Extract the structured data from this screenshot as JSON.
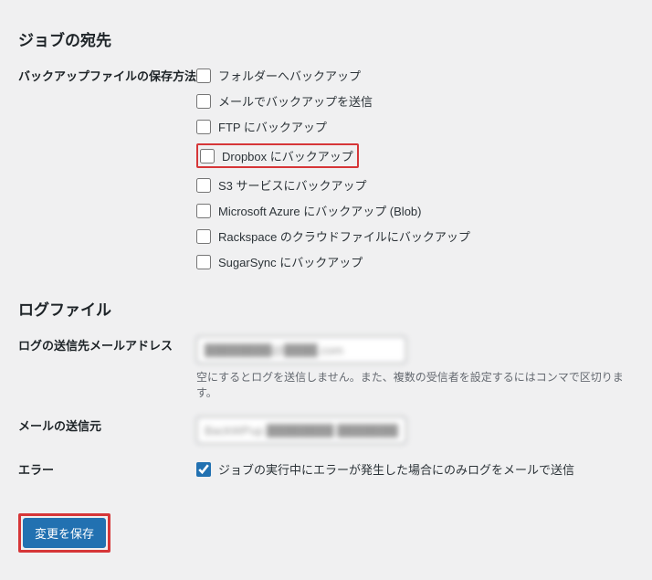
{
  "sections": {
    "destination": {
      "title": "ジョブの宛先",
      "rowLabel": "バックアップファイルの保存方法",
      "options": [
        {
          "label": "フォルダーへバックアップ",
          "checked": false,
          "highlight": false
        },
        {
          "label": "メールでバックアップを送信",
          "checked": false,
          "highlight": false
        },
        {
          "label": "FTP にバックアップ",
          "checked": false,
          "highlight": false
        },
        {
          "label": "Dropbox にバックアップ",
          "checked": false,
          "highlight": true
        },
        {
          "label": "S3 サービスにバックアップ",
          "checked": false,
          "highlight": false
        },
        {
          "label": "Microsoft Azure にバックアップ (Blob)",
          "checked": false,
          "highlight": false
        },
        {
          "label": "Rackspace のクラウドファイルにバックアップ",
          "checked": false,
          "highlight": false
        },
        {
          "label": "SugarSync にバックアップ",
          "checked": false,
          "highlight": false
        }
      ]
    },
    "logfiles": {
      "title": "ログファイル",
      "email_to": {
        "label": "ログの送信先メールアドレス",
        "value": "████████@████.com",
        "desc": "空にするとログを送信しません。また、複数の受信者を設定するにはコンマで区切ります。"
      },
      "email_from": {
        "label": "メールの送信元",
        "value": "BackWPup ████████ ████████@████.com"
      },
      "errors": {
        "label": "エラー",
        "checkbox_label": "ジョブの実行中にエラーが発生した場合にのみログをメールで送信",
        "checked": true
      }
    }
  },
  "submit_label": "変更を保存"
}
